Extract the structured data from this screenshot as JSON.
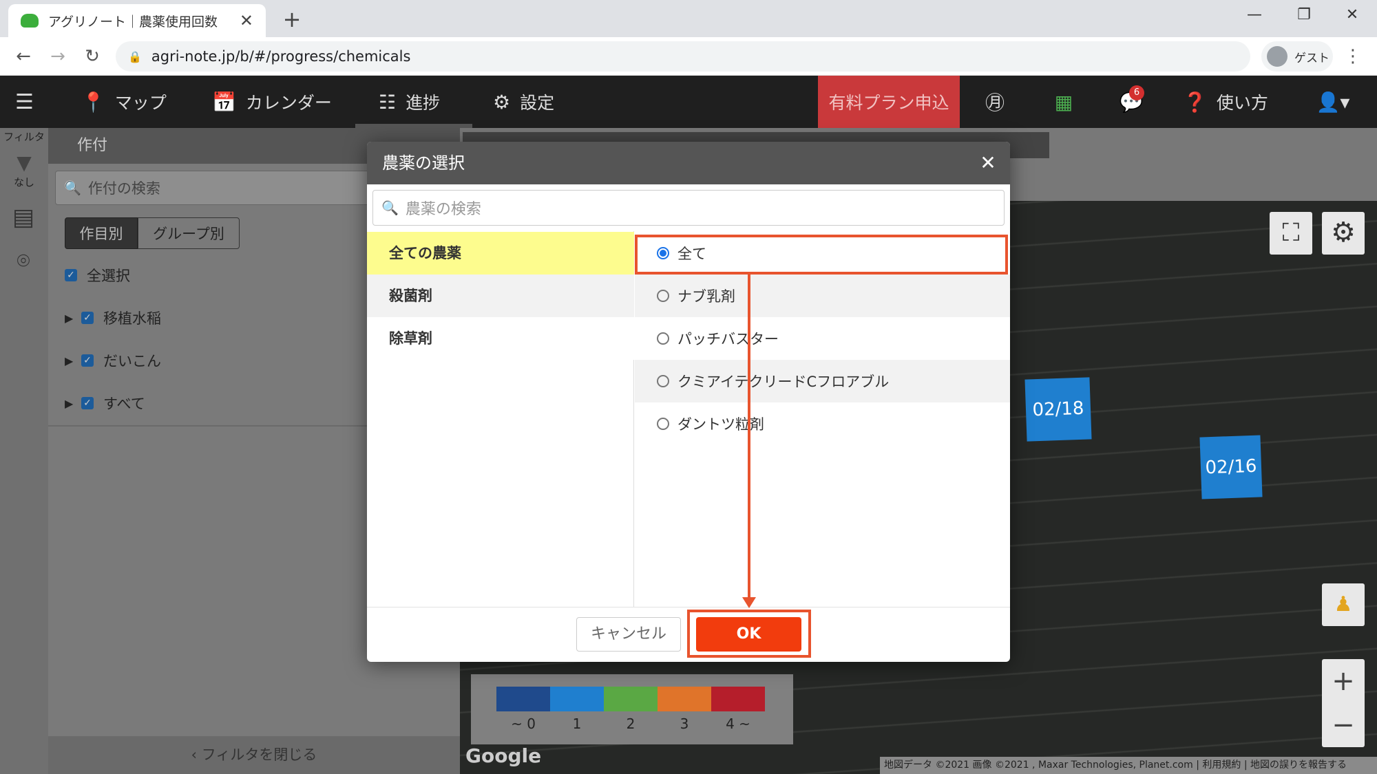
{
  "browser": {
    "tab_title": "アグリノート｜農薬使用回数",
    "url": "agri-note.jp/b/#/progress/chemicals",
    "profile_label": "ゲスト"
  },
  "app_nav": {
    "map": "マップ",
    "calendar": "カレンダー",
    "progress": "進捗",
    "settings": "設定",
    "paid_plan": "有料プラン申込",
    "help": "使い方",
    "notification_count": "6"
  },
  "filter_strip": {
    "label": "フィルタ",
    "status": "なし"
  },
  "crop_panel": {
    "header": "作付",
    "search_placeholder": "作付の検索",
    "segment_by_crop": "作目別",
    "segment_by_group": "グループ別",
    "select_all": "全選択",
    "items": [
      "移植水稲",
      "だいこん",
      "すべて"
    ],
    "close_filter": "フィルタを閉じる"
  },
  "map": {
    "plots": [
      "02/18",
      "02/16"
    ],
    "legend": {
      "labels": [
        "~ 0",
        "1",
        "2",
        "3",
        "4 ~"
      ],
      "colors": [
        "#1f4a8c",
        "#1f7fcf",
        "#5aa844",
        "#e0742a",
        "#b51e2b"
      ]
    },
    "google_logo": "Google",
    "attribution": "地図データ ©2021 画像 ©2021 , Maxar Technologies, Planet.com  |  利用規約  |  地図の誤りを報告する"
  },
  "modal": {
    "title": "農薬の選択",
    "search_placeholder": "農薬の検索",
    "categories": [
      "全ての農薬",
      "殺菌剤",
      "除草剤"
    ],
    "selected_category": "全ての農薬",
    "options": [
      "全て",
      "ナブ乳剤",
      "パッチバスター",
      "クミアイテクリードCフロアブル",
      "ダントツ粒剤"
    ],
    "selected_option": "全て",
    "cancel_label": "キャンセル",
    "ok_label": "OK"
  },
  "colors": {
    "accent_ok": "#f23c0d",
    "annotation": "#e8542e",
    "selected_category_bg": "#fdfc8e",
    "paid_plan_bg": "#c9393b"
  }
}
